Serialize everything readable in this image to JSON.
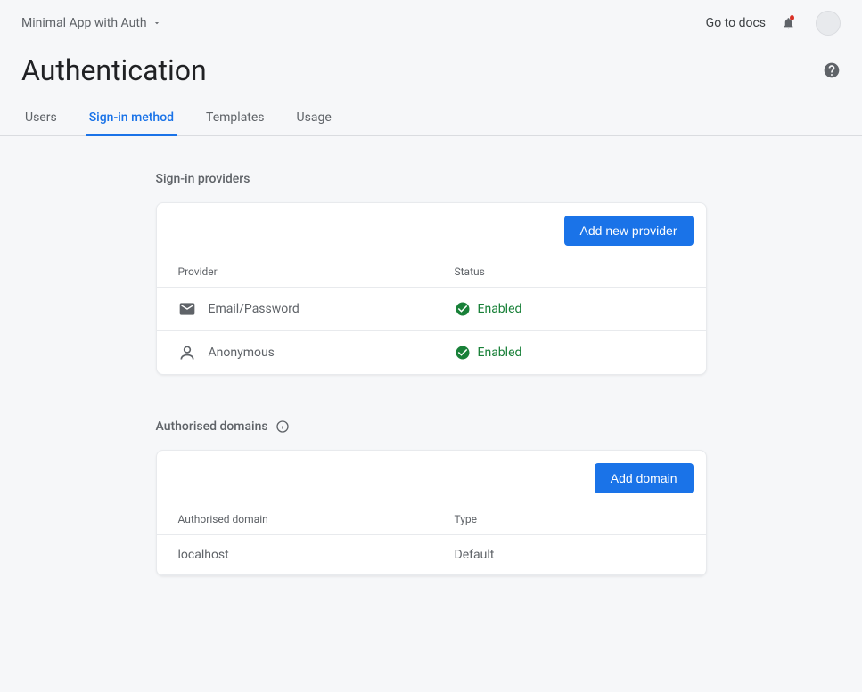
{
  "header": {
    "project_name": "Minimal App with Auth",
    "docs_link": "Go to docs"
  },
  "page_title": "Authentication",
  "tabs": {
    "users": "Users",
    "signin": "Sign-in method",
    "templates": "Templates",
    "usage": "Usage"
  },
  "sections": {
    "providers_title": "Sign-in providers",
    "domains_title": "Authorised domains"
  },
  "providers": {
    "add_button": "Add new provider",
    "col_provider": "Provider",
    "col_status": "Status",
    "items": [
      {
        "name": "Email/Password",
        "status": "Enabled"
      },
      {
        "name": "Anonymous",
        "status": "Enabled"
      }
    ]
  },
  "domains": {
    "add_button": "Add domain",
    "col_domain": "Authorised domain",
    "col_type": "Type",
    "items": [
      {
        "domain": "localhost",
        "type": "Default"
      }
    ]
  },
  "colors": {
    "primary": "#1a73e8",
    "success": "#188038"
  }
}
